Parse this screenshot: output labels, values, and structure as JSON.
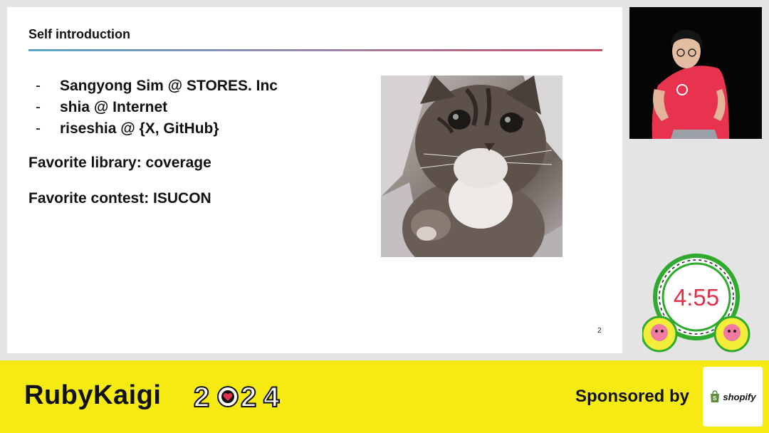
{
  "slide": {
    "title": "Self introduction",
    "bullets": [
      "Sangyong Sim @ STORES. Inc",
      "shia @ Internet",
      "riseshia @ {X, GitHub}"
    ],
    "bullet_marker": "-",
    "favorite_library": "Favorite library: coverage",
    "favorite_contest": "Favorite contest: ISUCON",
    "page_number": "2",
    "title_rule_colors": [
      "#5aa6c4",
      "#c8506a"
    ]
  },
  "timer": {
    "value": "4:55",
    "color": "#e0304a",
    "ring_color": "#2faa2f"
  },
  "footer": {
    "conference_name": "RubyKaigi",
    "year_digits": [
      "2",
      "",
      "2",
      "4"
    ],
    "sponsored_by": "Sponsored by",
    "sponsor_name": "shopify",
    "background": "#f5eb12"
  }
}
